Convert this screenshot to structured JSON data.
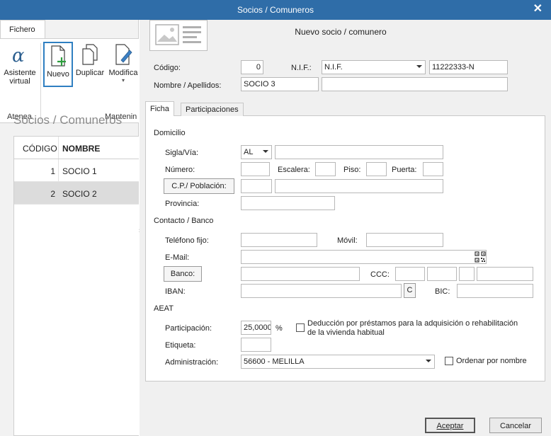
{
  "window": {
    "title": "Socios / Comuneros",
    "close_glyph": "✕"
  },
  "background": {
    "ribbon_tab": "Fichero",
    "buttons": [
      {
        "label_lines": [
          "Asistente",
          "virtual"
        ],
        "icon": "alpha-icon"
      },
      {
        "label": "Nuevo",
        "icon": "new-doc-icon"
      },
      {
        "label": "Duplicar",
        "icon": "duplicate-icon"
      },
      {
        "label": "Modifica",
        "icon": "edit-doc-icon"
      }
    ],
    "groups": [
      "Atenea",
      "Mantenin"
    ],
    "heading": "Socios / Comuneros",
    "grid": {
      "headers": [
        "CÓDIGO",
        "NOMBRE"
      ],
      "rows": [
        {
          "code": "1",
          "name": "SOCIO 1"
        },
        {
          "code": "2",
          "name": "SOCIO 2"
        }
      ]
    }
  },
  "dialog": {
    "title": "Nuevo socio / comunero",
    "codigo_label": "Código:",
    "codigo_value": "0",
    "nif_label": "N.I.F.:",
    "nif_type": "N.I.F.",
    "nif_value": "11222333-N",
    "nombre_label": "Nombre / Apellidos:",
    "nombre_value": "SOCIO 3",
    "nombre_value2": "",
    "tabs": [
      "Ficha",
      "Participaciones"
    ],
    "domicilio": {
      "section": "Domicilio",
      "sigla_label": "Sigla/Vía:",
      "sigla_value": "AL",
      "via_value": "",
      "numero_label": "Número:",
      "escalera_label": "Escalera:",
      "piso_label": "Piso:",
      "puerta_label": "Puerta:",
      "cp_button": "C.P./ Población:",
      "provincia_label": "Provincia:"
    },
    "contacto": {
      "section": "Contacto / Banco",
      "telefono_label": "Teléfono fijo:",
      "movil_label": "Móvil:",
      "email_label": "E-Mail:",
      "banco_button": "Banco:",
      "ccc_label": "CCC:",
      "iban_label": "IBAN:",
      "iban_c_button": "C",
      "bic_label": "BIC:"
    },
    "aeat": {
      "section": "AEAT",
      "participacion_label": "Participación:",
      "participacion_value": "25,0000",
      "percent": "%",
      "deduccion_label_1": "Deducción por préstamos para la adquisición o rehabilitación",
      "deduccion_label_2": "de la vivienda habitual",
      "etiqueta_label": "Etiqueta:",
      "administracion_label": "Administración:",
      "administracion_value": "56600 - MELILLA",
      "ordenar_label": "Ordenar por nombre"
    },
    "footer": {
      "accept": "Aceptar",
      "cancel": "Cancelar"
    }
  }
}
